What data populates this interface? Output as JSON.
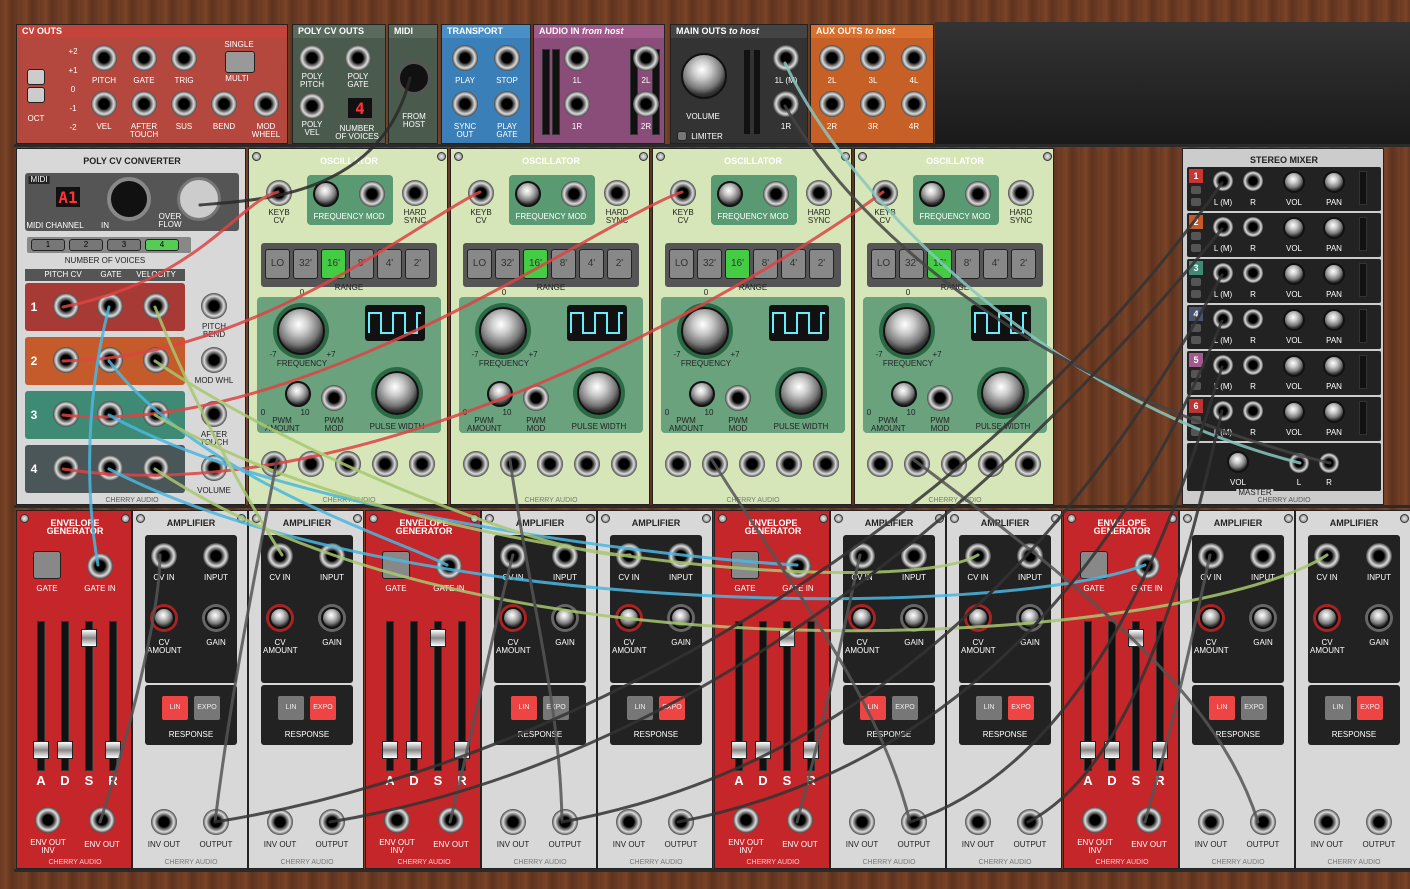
{
  "top": {
    "cv_outs": {
      "title": "CV OUTS",
      "octave_label": "OCT",
      "octaves": [
        "+2",
        "+1",
        "0",
        "-1",
        "-2"
      ],
      "mode_single": "SINGLE",
      "mode_multi": "MULTI",
      "jacks": [
        "PITCH",
        "GATE",
        "TRIG",
        "VEL",
        "AFTER TOUCH",
        "SUS",
        "BEND",
        "MOD WHEEL"
      ]
    },
    "poly_cv_outs": {
      "title": "POLY CV OUTS",
      "jacks": [
        "POLY PITCH",
        "POLY GATE",
        "POLY VEL"
      ],
      "voices_display": "4",
      "voices_label": "NUMBER OF VOICES"
    },
    "midi": {
      "title": "MIDI",
      "from_host": "FROM HOST"
    },
    "transport": {
      "title": "TRANSPORT",
      "jacks": [
        "PLAY",
        "STOP",
        "SYNC OUT",
        "PLAY GATE"
      ]
    },
    "audio_in": {
      "title": "AUDIO IN",
      "title_em": "from host",
      "jacks": [
        "1L",
        "2L",
        "1R",
        "2R"
      ]
    },
    "main_outs": {
      "title": "MAIN OUTS",
      "title_em": "to host",
      "volume": "VOLUME",
      "limiter": "LIMITER",
      "jacks": [
        "1L (M)",
        "1R"
      ]
    },
    "aux_outs": {
      "title": "AUX OUTS",
      "title_em": "to host",
      "jacks": [
        "2L",
        "3L",
        "4L",
        "2R",
        "3R",
        "4R"
      ]
    }
  },
  "poly_cv": {
    "title": "POLY CV CONVERTER",
    "midi": "MIDI",
    "midi_display": "A1",
    "midi_channel": "MIDI CHANNEL",
    "in": "IN",
    "overflow": "OVER FLOW",
    "voices_label": "NUMBER OF VOICES",
    "voice_buttons": [
      "1",
      "2",
      "3",
      "4"
    ],
    "active_voices": "4",
    "cols": [
      "PITCH CV",
      "GATE",
      "VELOCITY"
    ],
    "rows": [
      "1",
      "2",
      "3",
      "4"
    ],
    "right_jacks": [
      "PITCH BEND",
      "MOD WHL",
      "AFTER TOUCH",
      "VOLUME"
    ],
    "brand": "CHERRY AUDIO"
  },
  "oscillator": {
    "title": "OSCILLATOR",
    "keyb": "KEYB CV",
    "freq_mod": "FREQUENCY MOD",
    "hard_sync": "HARD SYNC",
    "ranges": [
      "LO",
      "32'",
      "16'",
      "8'",
      "4'",
      "2'"
    ],
    "active_range": "16'",
    "range": "RANGE",
    "frequency": "FREQUENCY",
    "freq_min": "-7",
    "freq_max": "+7",
    "freq_zero": "0",
    "pwm_amount": "PWM AMOUNT",
    "pwm_mod": "PWM MOD",
    "pwm_min": "0",
    "pwm_max": "10",
    "pulse_width": "PULSE WIDTH",
    "brand": "CHERRY AUDIO"
  },
  "stereo_mixer": {
    "title": "STEREO MIXER",
    "channels": [
      "1",
      "2",
      "3",
      "4",
      "5",
      "6"
    ],
    "l": "L (M)",
    "r": "R",
    "vol": "VOL",
    "pan": "PAN",
    "master": "MASTER",
    "master_vol": "VOL",
    "ml": "L",
    "mr": "R",
    "brand": "CHERRY AUDIO"
  },
  "envelope": {
    "title": "ENVELOPE GENERATOR",
    "gate": "GATE",
    "gate_in": "GATE IN",
    "sliders": [
      "A",
      "D",
      "S",
      "R"
    ],
    "env_inv": "ENV OUT INV",
    "env_out": "ENV OUT",
    "brand": "CHERRY AUDIO"
  },
  "amplifier": {
    "title": "AMPLIFIER",
    "cv_in": "CV IN",
    "input": "INPUT",
    "cv_amount": "CV AMOUNT",
    "gain": "GAIN",
    "lin": "LIN",
    "expo": "EXPO",
    "response": "RESPONSE",
    "inv_out": "INV OUT",
    "output": "OUTPUT",
    "brand": "CHERRY AUDIO"
  }
}
